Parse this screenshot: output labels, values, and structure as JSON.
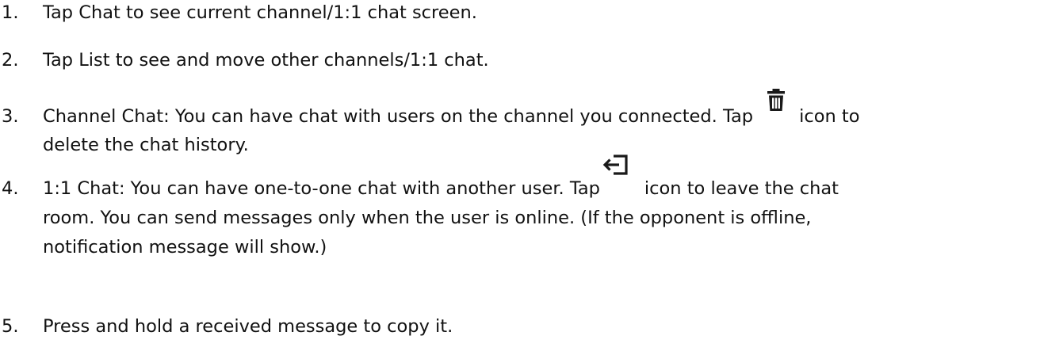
{
  "instructions": [
    {
      "number": "1.",
      "text": "Tap Chat to see current channel/1:1 chat screen."
    },
    {
      "number": "2.",
      "text": "Tap List to see and move other channels/1:1 chat."
    },
    {
      "number": "3.",
      "text_before_icon": "Channel Chat: You can have chat with users on the channel you connected. Tap",
      "icon": "trash-icon",
      "text_after_icon": "icon to",
      "line2": "delete the chat history."
    },
    {
      "number": "4.",
      "text_before_icon": "1:1 Chat: You can have one-to-one chat with another user. Tap",
      "icon": "exit-icon",
      "text_after_icon": "icon to leave the chat",
      "line2": "room. You can send messages only when the user is online. (If the opponent is offline,",
      "line3": "notification message will show.)"
    },
    {
      "number": "5.",
      "text": "Press and hold a received message to copy it."
    }
  ],
  "text_color": "#111111",
  "icon_color": "#1a1a1a"
}
